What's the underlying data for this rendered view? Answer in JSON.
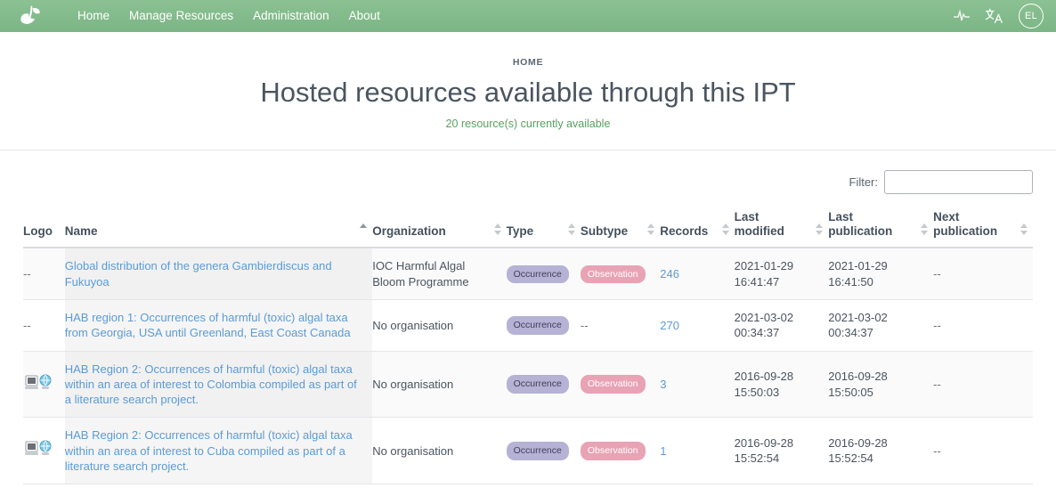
{
  "navbar": {
    "logo_icon": "leaf-sprout-logo",
    "links": [
      {
        "label": "Home",
        "name": "home"
      },
      {
        "label": "Manage Resources",
        "name": "manage-resources"
      },
      {
        "label": "Administration",
        "name": "administration"
      },
      {
        "label": "About",
        "name": "about"
      }
    ],
    "right_icons": [
      {
        "icon": "activity-pulse-icon",
        "name": "activity"
      },
      {
        "icon": "translate-icon",
        "name": "translate",
        "glyph": "文A"
      }
    ],
    "avatar_initials": "EL",
    "background_color": "#7fba86"
  },
  "header": {
    "breadcrumb": "HOME",
    "title": "Hosted resources available through this IPT",
    "subtitle": "20 resource(s) currently available",
    "subtitle_color": "#5aa05f"
  },
  "filter": {
    "label": "Filter:",
    "value": "",
    "placeholder": ""
  },
  "table": {
    "columns": [
      {
        "label": "Logo",
        "name": "logo",
        "sortable": false,
        "sorted": "none"
      },
      {
        "label": "Name",
        "name": "name",
        "sortable": true,
        "sorted": "asc"
      },
      {
        "label": "Organization",
        "name": "organization",
        "sortable": true,
        "sorted": "none"
      },
      {
        "label": "Type",
        "name": "type",
        "sortable": true,
        "sorted": "none"
      },
      {
        "label": "Subtype",
        "name": "subtype",
        "sortable": true,
        "sorted": "none"
      },
      {
        "label": "Records",
        "name": "records",
        "sortable": true,
        "sorted": "none"
      },
      {
        "label": "Last modified",
        "name": "last-modified",
        "sortable": true,
        "sorted": "none"
      },
      {
        "label": "Last publication",
        "name": "last-publication",
        "sortable": true,
        "sorted": "none"
      },
      {
        "label": "Next publication",
        "name": "next-publication",
        "sortable": true,
        "sorted": "none"
      }
    ],
    "rows": [
      {
        "logo": "--",
        "has_logo_image": false,
        "name": "Global distribution of the genera Gambierdiscus and Fukuyoa",
        "organization": "IOC Harmful Algal Bloom Programme",
        "type": "Occurrence",
        "subtype": "Observation",
        "records": "246",
        "last_modified": "2021-01-29 16:41:47",
        "last_publication": "2021-01-29 16:41:50",
        "next_publication": "--"
      },
      {
        "logo": "--",
        "has_logo_image": false,
        "name": "HAB region 1: Occurrences of harmful (toxic) algal taxa from Georgia, USA until Greenland, East Coast Canada",
        "organization": "No organisation",
        "type": "Occurrence",
        "subtype": "--",
        "records": "270",
        "last_modified": "2021-03-02 00:34:37",
        "last_publication": "2021-03-02 00:34:37",
        "next_publication": "--"
      },
      {
        "logo": "resource-logo-image",
        "has_logo_image": true,
        "name": "HAB Region 2: Occurrences of harmful (toxic) algal taxa within an area of interest to Colombia compiled as part of a literature search project.",
        "organization": "No organisation",
        "type": "Occurrence",
        "subtype": "Observation",
        "records": "3",
        "last_modified": "2016-09-28 15:50:03",
        "last_publication": "2016-09-28 15:50:05",
        "next_publication": "--"
      },
      {
        "logo": "resource-logo-image",
        "has_logo_image": true,
        "name": "HAB Region 2: Occurrences of harmful (toxic) algal taxa within an area of interest to Cuba compiled as part of a literature search project.",
        "organization": "No organisation",
        "type": "Occurrence",
        "subtype": "Observation",
        "records": "1",
        "last_modified": "2016-09-28 15:52:54",
        "last_publication": "2016-09-28 15:52:54",
        "next_publication": "--"
      }
    ]
  },
  "colors": {
    "badge_occurrence": "#b5b2d6",
    "badge_observation": "#e8a3b4",
    "link": "#5b9bd5"
  }
}
